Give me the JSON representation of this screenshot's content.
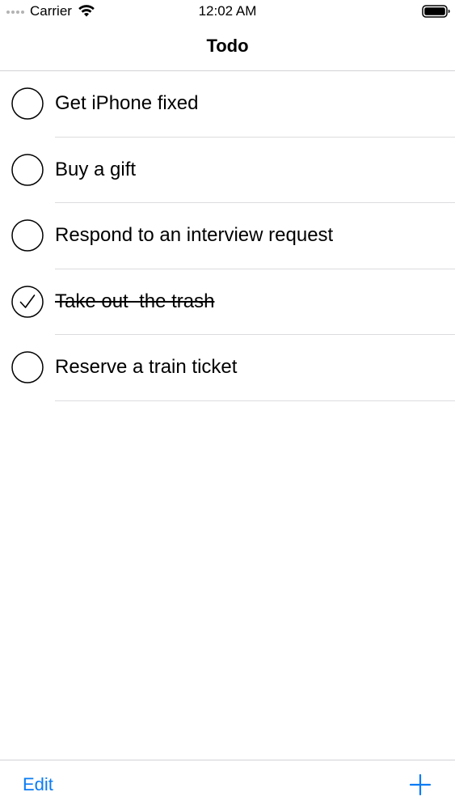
{
  "status_bar": {
    "carrier": "Carrier",
    "time": "12:02 AM",
    "signal_icon": "signal-dots-icon",
    "wifi_icon": "wifi-icon",
    "battery_icon": "battery-icon"
  },
  "nav": {
    "title": "Todo"
  },
  "todos": [
    {
      "text": "Get iPhone fixed",
      "done": false
    },
    {
      "text": "Buy a gift",
      "done": false
    },
    {
      "text": "Respond to an interview request",
      "done": false
    },
    {
      "text": "Take out  the trash",
      "done": true
    },
    {
      "text": "Reserve a train ticket",
      "done": false
    }
  ],
  "toolbar": {
    "edit_label": "Edit",
    "add_icon": "plus-icon"
  },
  "colors": {
    "accent": "#0a7cf5",
    "separator": "#dcdcdf",
    "text": "#000000"
  }
}
